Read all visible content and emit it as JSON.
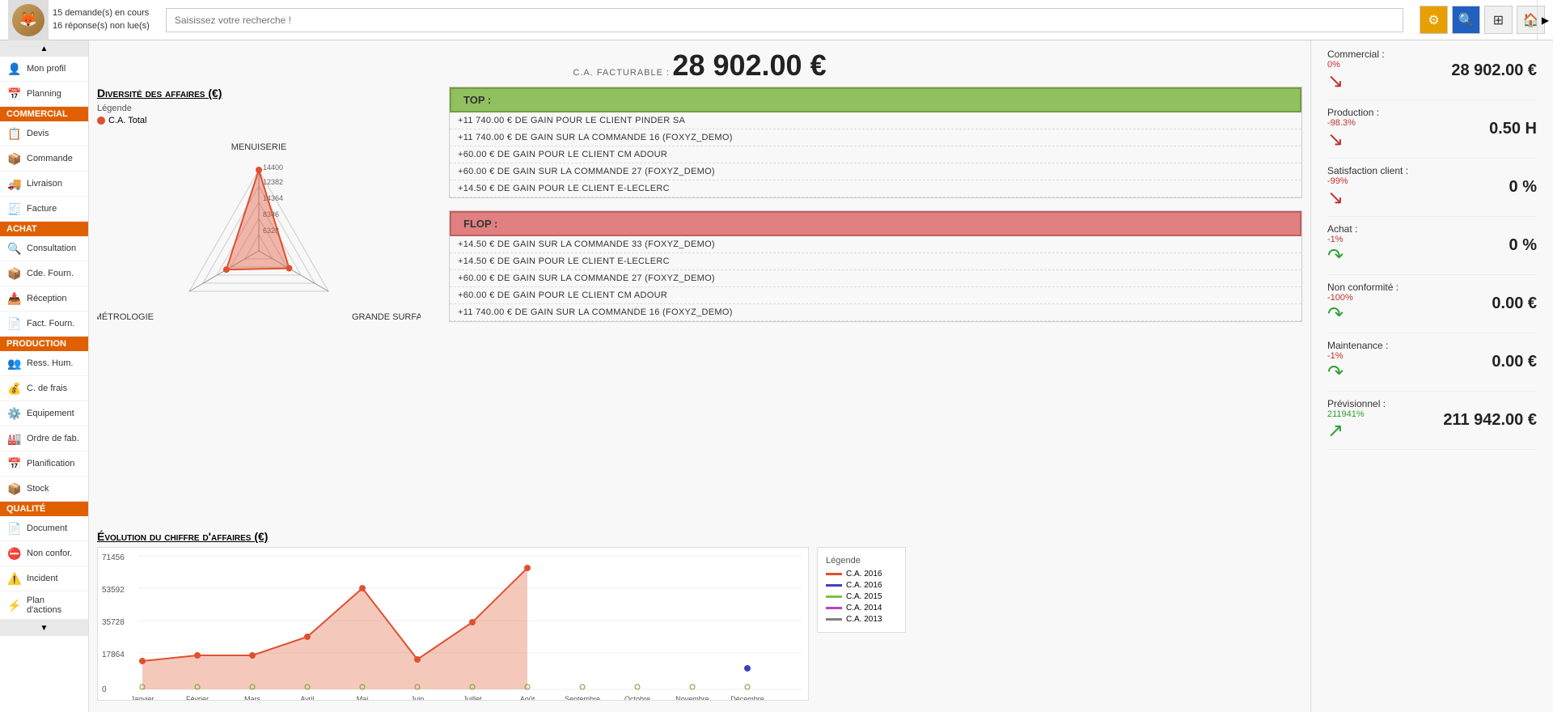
{
  "header": {
    "notifications": {
      "line1": "15 demande(s) en cours",
      "line2": "16 réponse(s) non lue(s)"
    },
    "search_placeholder": "Saisissez votre recherche !",
    "icons": [
      "gear",
      "search",
      "grid",
      "home"
    ]
  },
  "sidebar": {
    "scroll_up": "▲",
    "scroll_down": "▼",
    "items": [
      {
        "label": "Mon profil",
        "icon": "👤",
        "section": null
      },
      {
        "label": "Planning",
        "icon": "📅",
        "section": null
      },
      {
        "label": "Commercial",
        "icon": null,
        "section": "COMMERCIAL"
      },
      {
        "label": "Devis",
        "icon": "📋",
        "section": null
      },
      {
        "label": "Commande",
        "icon": "📦",
        "section": null
      },
      {
        "label": "Livraison",
        "icon": "🚚",
        "section": null
      },
      {
        "label": "Facture",
        "icon": "🧾",
        "section": null
      },
      {
        "label": "Achat",
        "icon": null,
        "section": "ACHAT"
      },
      {
        "label": "Consultation",
        "icon": "🔍",
        "section": null
      },
      {
        "label": "Cde. Fourn.",
        "icon": "📦",
        "section": null
      },
      {
        "label": "Réception",
        "icon": "📥",
        "section": null
      },
      {
        "label": "Fact. Fourn.",
        "icon": "📄",
        "section": null
      },
      {
        "label": "Production",
        "icon": null,
        "section": "PRODUCTION"
      },
      {
        "label": "Ress. Hum.",
        "icon": "👥",
        "section": null
      },
      {
        "label": "C. de frais",
        "icon": "💰",
        "section": null
      },
      {
        "label": "Equipement",
        "icon": "⚙️",
        "section": null
      },
      {
        "label": "Ordre de fab.",
        "icon": "🏭",
        "section": null
      },
      {
        "label": "Planification",
        "icon": "📅",
        "section": null
      },
      {
        "label": "Stock",
        "icon": "📦",
        "section": null
      },
      {
        "label": "Qualité",
        "icon": null,
        "section": "QUALITE"
      },
      {
        "label": "Document",
        "icon": "📄",
        "section": null
      },
      {
        "label": "Non confor.",
        "icon": "⛔",
        "section": null
      },
      {
        "label": "Incident",
        "icon": "⚠️",
        "section": null
      },
      {
        "label": "Plan d'actions",
        "icon": "⚡",
        "section": null
      }
    ]
  },
  "main": {
    "kpi_label": "C.A. FACTURABLE :",
    "kpi_value": "28 902.00 €",
    "radar": {
      "title": "Diversité des affaires (€)",
      "legend_label": "Légende",
      "legend_items": [
        {
          "label": "C.A. Total",
          "color": "#e05030"
        }
      ],
      "axes": [
        "MENUISERIE",
        "GRANDE SURFACE",
        "MÉTROLOGIE"
      ],
      "values": [
        14400,
        6328,
        8346
      ],
      "grid_values": [
        "14400",
        "12382",
        "14364",
        "8346",
        "6328"
      ]
    },
    "topflop": {
      "top_label": "TOP :",
      "top_items": [
        "+11 740.00 € DE GAIN POUR LE CLIENT PINDER SA",
        "+11 740.00 € DE GAIN SUR LA COMMANDE 16 (FOXYZ_DEMO)",
        "+60.00 € DE GAIN POUR LE CLIENT CM ADOUR",
        "+60.00 € DE GAIN SUR LA COMMANDE 27 (FOXYZ_DEMO)",
        "+14.50 € DE GAIN POUR LE CLIENT E-LECLERC"
      ],
      "flop_label": "FLOP :",
      "flop_items": [
        "+14.50 € DE GAIN SUR LA COMMANDE 33 (FOXYZ_DEMO)",
        "+14.50 € DE GAIN POUR LE CLIENT E-LECLERC",
        "+60.00 € DE GAIN SUR LA COMMANDE 27 (FOXYZ_DEMO)",
        "+60.00 € DE GAIN POUR LE CLIENT CM ADOUR",
        "+11 740.00 € DE GAIN SUR LA COMMANDE 16 (FOXYZ_DEMO)"
      ]
    },
    "kpi_panel": {
      "items": [
        {
          "name": "Commercial :",
          "percent": "0%",
          "value": "28 902.00 €",
          "trend": "down",
          "percent_color": "down"
        },
        {
          "name": "Production :",
          "percent": "-98.3%",
          "value": "0.50 H",
          "trend": "down",
          "percent_color": "down"
        },
        {
          "name": "Satisfaction client :",
          "percent": "-99%",
          "value": "0 %",
          "trend": "down",
          "percent_color": "down"
        },
        {
          "name": "Achat :",
          "percent": "-1%",
          "value": "0 %",
          "trend": "sideways",
          "percent_color": "down"
        },
        {
          "name": "Non conformité :",
          "percent": "-100%",
          "value": "0.00 €",
          "trend": "sideways",
          "percent_color": "down"
        },
        {
          "name": "Maintenance :",
          "percent": "-1%",
          "value": "0.00 €",
          "trend": "sideways",
          "percent_color": "down"
        },
        {
          "name": "Prévisionnel :",
          "percent": "211941%",
          "value": "211 942.00 €",
          "trend": "up",
          "percent_color": "up"
        }
      ]
    },
    "line_chart": {
      "title": "Évolution du chiffre d'affaires (€)",
      "y_values": [
        "71456",
        "53592",
        "35728",
        "17864",
        "0"
      ],
      "x_labels": [
        "Janvier",
        "Février",
        "Mars",
        "Avril",
        "Mai",
        "Juin",
        "Juillet",
        "Août",
        "Septembre",
        "Octobre",
        "Novembre",
        "Décembre"
      ],
      "legend": [
        {
          "label": "C.A. 2016",
          "color": "#e05030"
        },
        {
          "label": "C.A. 2016",
          "color": "#4040c0"
        },
        {
          "label": "C.A. 2015",
          "color": "#80c040"
        },
        {
          "label": "C.A. 2014",
          "color": "#c040c0"
        },
        {
          "label": "C.A. 2013",
          "color": "#808080"
        }
      ],
      "series_orange": [
        12000,
        18000,
        18000,
        28000,
        54000,
        16000,
        34000,
        65000,
        0,
        0,
        0,
        0
      ],
      "series_blue": [
        0,
        0,
        0,
        0,
        0,
        0,
        0,
        0,
        0,
        0,
        0,
        11000
      ]
    }
  }
}
